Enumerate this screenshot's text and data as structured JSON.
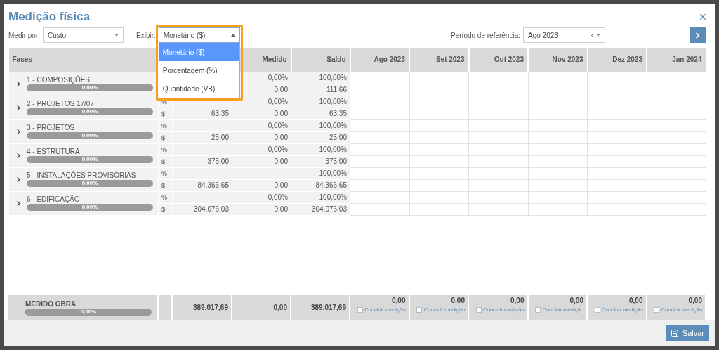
{
  "dialog": {
    "title": "Medição física"
  },
  "filters": {
    "measure_by": {
      "label": "Medir por:",
      "value": "Custo"
    },
    "display": {
      "label": "Exibir:",
      "value": "Monetário ($)",
      "expanded": true,
      "options": [
        {
          "label": "Monetário ($)",
          "selected": true
        },
        {
          "label": "Porcentagem (%)",
          "selected": false
        },
        {
          "label": "Quantidade (VB)",
          "selected": false
        }
      ]
    },
    "reference_period": {
      "label": "Período de referência:",
      "value": "Ago 2023"
    }
  },
  "table": {
    "columns": [
      "Fases",
      "Medido",
      "Saldo",
      "Ago 2023",
      "Set 2023",
      "Out 2023",
      "Nov 2023",
      "Dez 2023",
      "Jan 2024"
    ],
    "groups": [
      {
        "name": "1 - COMPOSIÇÕES",
        "expanded": false,
        "progress": {
          "level": 0,
          "label": "0,00%"
        },
        "rows": [
          {
            "medido": "0,00%",
            "saldo": "100,00%"
          },
          {
            "medido": "0,00",
            "saldo": "111,66"
          }
        ]
      },
      {
        "name": "2 - PROJETOS 17/07",
        "expanded": false,
        "progress": {
          "level": 0,
          "label": "0,00%"
        },
        "rows": [
          {
            "unit": "%",
            "medido": "0,00%",
            "saldo": "100,00%"
          },
          {
            "unit": "$",
            "orcado": "63,35",
            "medido": "0,00",
            "saldo": "63,35"
          }
        ]
      },
      {
        "name": "3 - PROJETOS",
        "expanded": false,
        "progress": {
          "level": 0,
          "label": "0,00%"
        },
        "rows": [
          {
            "unit": "%",
            "medido": "0,00%",
            "saldo": "100,00%"
          },
          {
            "unit": "$",
            "orcado": "25,00",
            "medido": "0,00",
            "saldo": "25,00"
          }
        ]
      },
      {
        "name": "4 - ESTRUTURA",
        "expanded": false,
        "progress": {
          "level": 0,
          "label": "0,00%"
        },
        "rows": [
          {
            "unit": "%",
            "medido": "0,00%",
            "saldo": "100,00%"
          },
          {
            "unit": "$",
            "orcado": "375,00",
            "medido": "0,00",
            "saldo": "375,00"
          }
        ]
      },
      {
        "name": "5 - INSTALAÇÕES PROVISÓRIAS",
        "expanded": false,
        "progress": {
          "level": 0,
          "label": "0,00%"
        },
        "rows": [
          {
            "unit": "%",
            "saldo": "100,00%"
          },
          {
            "unit": "$",
            "orcado": "84.366,65",
            "medido": "0,00",
            "saldo": "84.366,65"
          }
        ]
      },
      {
        "name": "6 - EDIFICAÇÃO",
        "expanded": false,
        "progress": {
          "level": 0,
          "label": "0,00%"
        },
        "rows": [
          {
            "unit": "%",
            "medido": "0,00%",
            "saldo": "100,00%"
          },
          {
            "unit": "$",
            "orcado": "304.076,03",
            "medido": "0,00",
            "saldo": "304.076,03"
          }
        ]
      }
    ],
    "total": {
      "label": "MEDIDO OBRA",
      "progress": {
        "level": 0,
        "label": "0,00%"
      },
      "orcado": "389.017,69",
      "medido": "0,00",
      "saldo": "389.017,69",
      "months": [
        {
          "value": "0,00",
          "done": {
            "label": "Concluir medição",
            "checked": false
          }
        },
        {
          "value": "0,00",
          "done": {
            "label": "Concluir medição",
            "checked": false
          }
        },
        {
          "value": "0,00",
          "done": {
            "label": "Concluir medição",
            "checked": false
          }
        },
        {
          "value": "0,00",
          "done": {
            "label": "Concluir medição",
            "checked": false
          }
        },
        {
          "value": "0,00",
          "done": {
            "label": "Concluir medição",
            "checked": false
          }
        },
        {
          "value": "0,00",
          "done": {
            "label": "Concluir medição",
            "checked": false
          }
        }
      ]
    }
  },
  "save_button": "Salvar"
}
